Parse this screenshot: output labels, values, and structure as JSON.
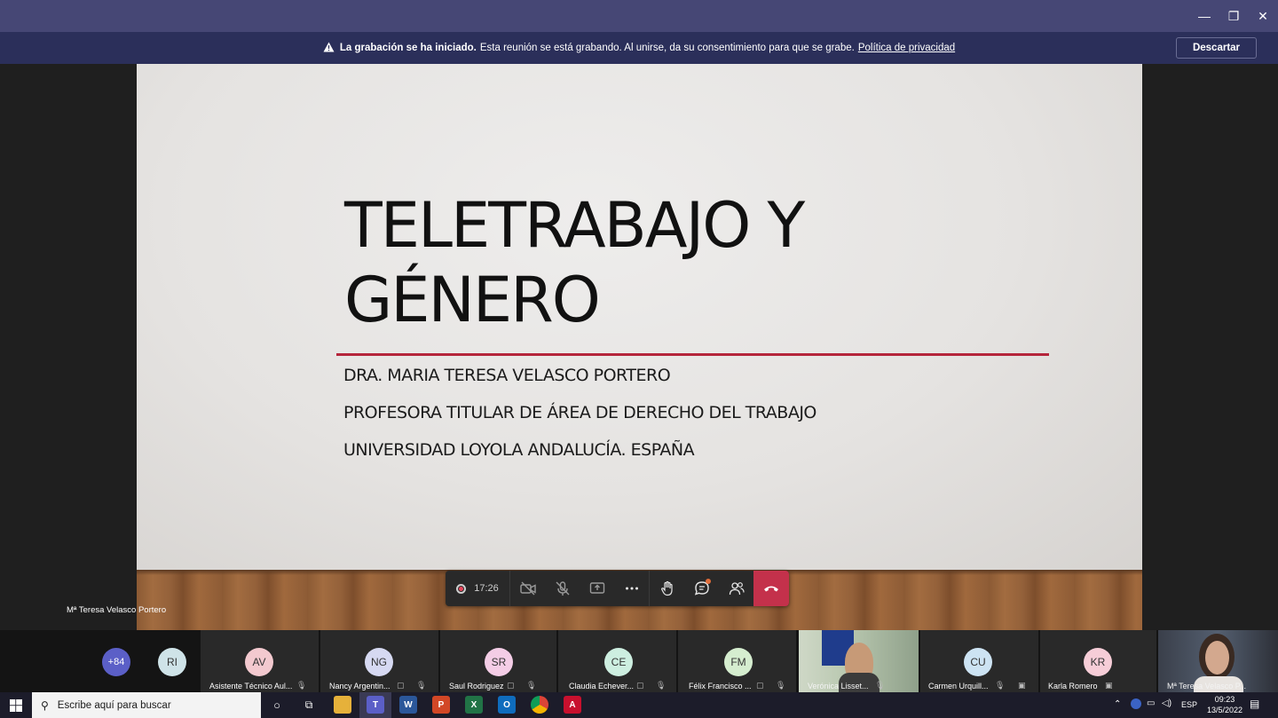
{
  "window": {
    "minimize": "—",
    "restore": "❐",
    "close": "✕"
  },
  "banner": {
    "title": "La grabación se ha iniciado.",
    "message": "Esta reunión se está grabando. Al unirse, da su consentimiento para que se grabe.",
    "link": "Política de privacidad",
    "dismiss_label": "Descartar"
  },
  "slide": {
    "title_line1": "TELETRABAJO Y",
    "title_line2": "GÉNERO",
    "line1": "DRA. MARIA TERESA VELASCO PORTERO",
    "line2": "PROFESORA TITULAR DE ÁREA DE DERECHO DEL TRABAJO",
    "line3": "UNIVERSIDAD LOYOLA ANDALUCÍA. ESPAÑA",
    "accent_color": "#b5253b"
  },
  "presenter": {
    "name": "Mª Teresa Velasco Portero"
  },
  "controls": {
    "recording_time": "17:26",
    "hangup_color": "#c4314b"
  },
  "participants": {
    "overflow": "+84",
    "ri": "RI",
    "list": [
      {
        "initials": "AV",
        "name": "Asistente Técnico Aul...",
        "color": "#f3c9cf"
      },
      {
        "initials": "NG",
        "name": "Nancy Argentin...",
        "color": "#d6d9f2"
      },
      {
        "initials": "SR",
        "name": "Saul Rodriguez",
        "color": "#f4cde6"
      },
      {
        "initials": "CE",
        "name": "Claudia Echever...",
        "color": "#cdeee0"
      },
      {
        "initials": "FM",
        "name": "Félix Francisco ...",
        "color": "#d5edcf"
      },
      {
        "initials": "",
        "name": "Verónica Lisset...",
        "color": ""
      },
      {
        "initials": "CU",
        "name": "Carmen Urquill...",
        "color": "#cde3f3"
      },
      {
        "initials": "KR",
        "name": "Karla Romero",
        "color": "#f6cdd7"
      },
      {
        "initials": "",
        "name": "Mª Teresa Velasco P...",
        "color": ""
      }
    ]
  },
  "taskbar": {
    "search_placeholder": "Escribe aquí para buscar",
    "language": "ESP",
    "time": "09:23",
    "date": "13/5/2022"
  }
}
